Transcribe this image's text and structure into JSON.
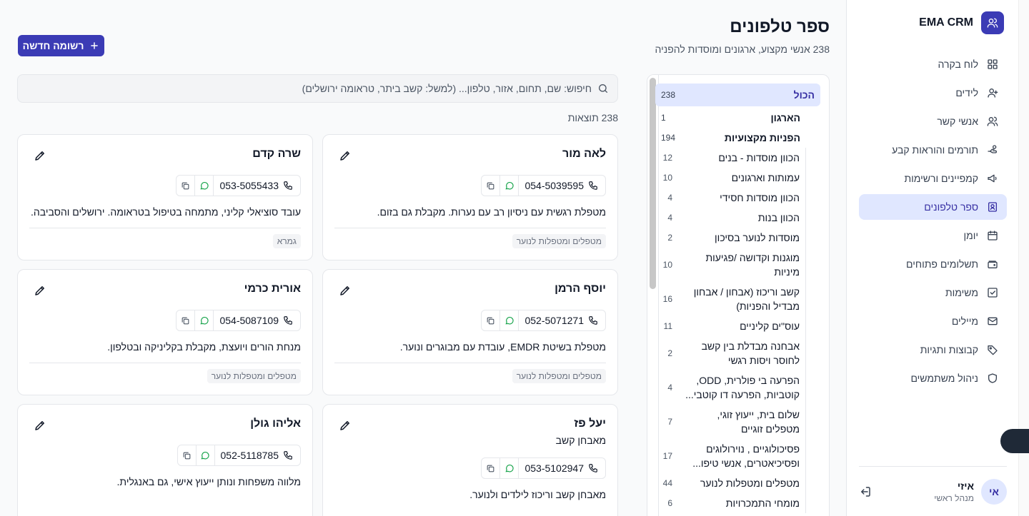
{
  "app": {
    "name": "EMA CRM"
  },
  "nav": [
    {
      "label": "לוח בקרה",
      "icon": "dashboard-icon"
    },
    {
      "label": "לידים",
      "icon": "user-plus-icon"
    },
    {
      "label": "אנשי קשר",
      "icon": "users-icon"
    },
    {
      "label": "תורמים והוראות קבע",
      "icon": "hand-coins-icon"
    },
    {
      "label": "קמפיינים ורשימות",
      "icon": "megaphone-icon"
    },
    {
      "label": "ספר טלפונים",
      "icon": "contact-book-icon",
      "active": true
    },
    {
      "label": "יומן",
      "icon": "calendar-icon"
    },
    {
      "label": "תשלומים פתוחים",
      "icon": "wallet-icon"
    },
    {
      "label": "משימות",
      "icon": "checkbox-icon"
    },
    {
      "label": "מיילים",
      "icon": "mail-icon"
    },
    {
      "label": "קבוצות ותגיות",
      "icon": "tag-icon"
    },
    {
      "label": "ניהול משתמשים",
      "icon": "shield-icon"
    }
  ],
  "user": {
    "initials": "אי",
    "name": "איזי",
    "role": "מנהל ראשי"
  },
  "header": {
    "title": "ספר טלפונים",
    "subtitle": "238 אנשי מקצוע, ארגונים ומוסדות להפניה",
    "new_button": "רשומה חדשה"
  },
  "categories": {
    "main": [
      {
        "label": "הכול",
        "count": "238",
        "active": true
      },
      {
        "label": "הארגון",
        "count": "1"
      },
      {
        "label": "הפניות מקצועיות",
        "count": "194"
      }
    ],
    "sub": [
      {
        "label": "הכוון מוסדות - בנים",
        "count": "12"
      },
      {
        "label": "עמותות וארגונים",
        "count": "10"
      },
      {
        "label": "הכוון מוסדות חסידי",
        "count": "4"
      },
      {
        "label": "הכוון בנות",
        "count": "4"
      },
      {
        "label": "מוסדות לנוער בסיכון",
        "count": "2"
      },
      {
        "label": "מוגנות וקדושה /פגיעות מיניות",
        "count": "10"
      },
      {
        "label": "קשב וריכוז (אבחון / אבחון מבדיל והפניות)",
        "count": "16"
      },
      {
        "label": "עוס\"ים קליניים",
        "count": "11"
      },
      {
        "label": "אבחנה מבדלת בין קשב לחוסר ויסות רגשי",
        "count": "2"
      },
      {
        "label": "הפרעה בי פולרית, ODD, קוטביות, הפרעה דו קוטבי...",
        "count": "4"
      },
      {
        "label": "שלום בית, ייעוץ זוגי, מטפלים זוגיים",
        "count": "7"
      },
      {
        "label": "פסיכולוגיים , נוירולוגים ופסיכיאטרים, אנשי טיפו...",
        "count": "17"
      },
      {
        "label": "מטפלים ומטפלות לנוער",
        "count": "44"
      },
      {
        "label": "מומחי התמכרויות",
        "count": "6"
      }
    ]
  },
  "search": {
    "placeholder": "חיפוש: שם, תחום, אזור, טלפון... (למשל: קשב ביתר, טראומה ירושלים)"
  },
  "results_label": "238 תוצאות",
  "cards": [
    {
      "name": "לאה מור",
      "role": "",
      "phone": "054-5039595",
      "desc": "מטפלת רגשית עם ניסיון רב עם נערות. מקבלת גם בזום.",
      "tag": "מטפלים ומטפלות לנוער"
    },
    {
      "name": "שרה קדם",
      "role": "",
      "phone": "053-5055433",
      "desc": "עובד סוציאלי קליני, מתמחה בטיפול בטראומה. ירושלים והסביבה.",
      "tag": "גמראAא"
    },
    {
      "name": "יוסף הרמן",
      "role": "",
      "phone": "052-5071271",
      "desc": "מטפלת בשיטת EMDR, עובדת עם מבוגרים ונוער.",
      "tag": "מטפלים ומטפלות לנוער"
    },
    {
      "name": "אורית כרמי",
      "role": "",
      "phone": "054-5087109",
      "desc": "מנחת הורים ויועצת, מקבלת בקליניקה ובטלפון.",
      "tag": "מטפלים ומטפלות לנוער"
    },
    {
      "name": "יעל פז",
      "role": "מאבחן קשב",
      "phone": "053-5102947",
      "desc": "מאבחן קשב וריכוז לילדים ולנוער.",
      "tag": ""
    },
    {
      "name": "אליהו גולן",
      "role": "",
      "phone": "052-5118785",
      "desc": "מלווה משפחות ונותן ייעוץ אישי, גם באנגלית.",
      "tag": ""
    }
  ],
  "colors": {
    "accent": "#3b3bb5",
    "active_bg": "#e0e7ff",
    "active_text": "#3730a3"
  }
}
